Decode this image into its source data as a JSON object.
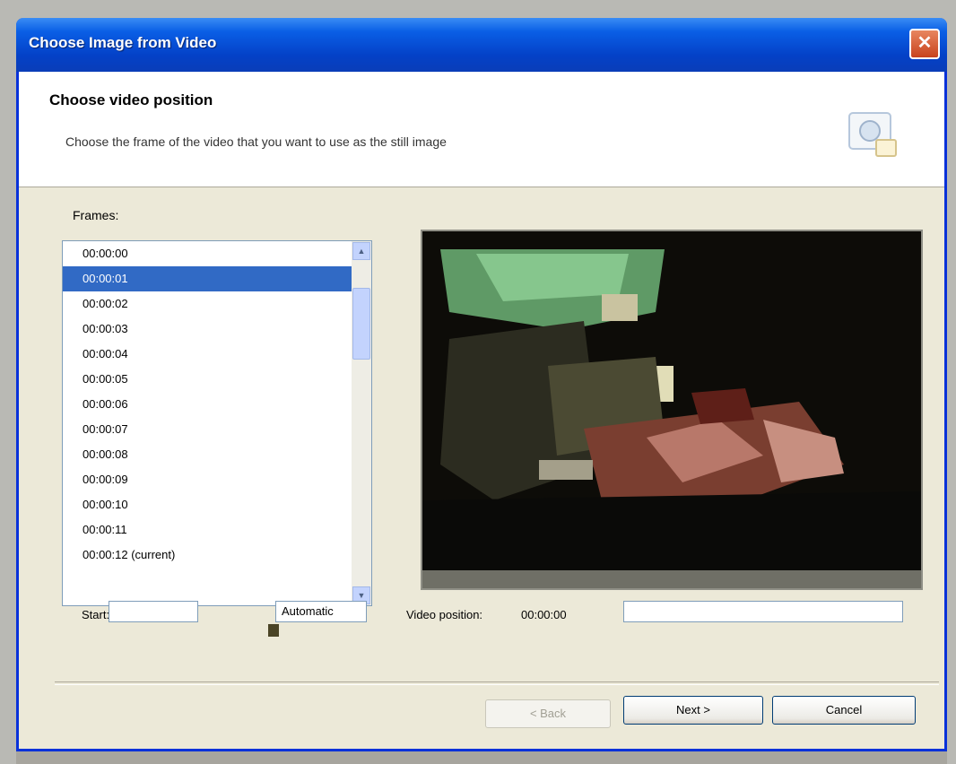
{
  "window": {
    "title": "Choose Image from Video",
    "close_glyph": "✕"
  },
  "header": {
    "title": "Choose video position",
    "subtitle": "Choose the frame of the video that you want to use as the still image"
  },
  "frame_list": {
    "label": "Frames:",
    "items": [
      "00:00:00",
      "00:00:01",
      "00:00:02",
      "00:00:03",
      "00:00:04",
      "00:00:05",
      "00:00:06",
      "00:00:07",
      "00:00:08",
      "00:00:09",
      "00:00:10",
      "00:00:11",
      "00:00:12 (current)"
    ],
    "selected_index": 1
  },
  "controls": {
    "start_label": "Start:",
    "start_value": "",
    "color_label": "",
    "color_value": "Automatic",
    "position_label": "Video position:",
    "position_value": "00:00:00",
    "position_field_value": ""
  },
  "buttons": {
    "back": "< Back",
    "next": "Next >",
    "cancel": "Cancel"
  },
  "icons": {
    "header": "camera-wizard-icon",
    "close": "close-icon",
    "scroll_up": "scroll-up-arrow-icon",
    "scroll_down": "scroll-down-arrow-icon"
  },
  "colors": {
    "titlebar": "#0a5fe6",
    "selection": "#316ac5",
    "dialog": "#ece9d8"
  }
}
